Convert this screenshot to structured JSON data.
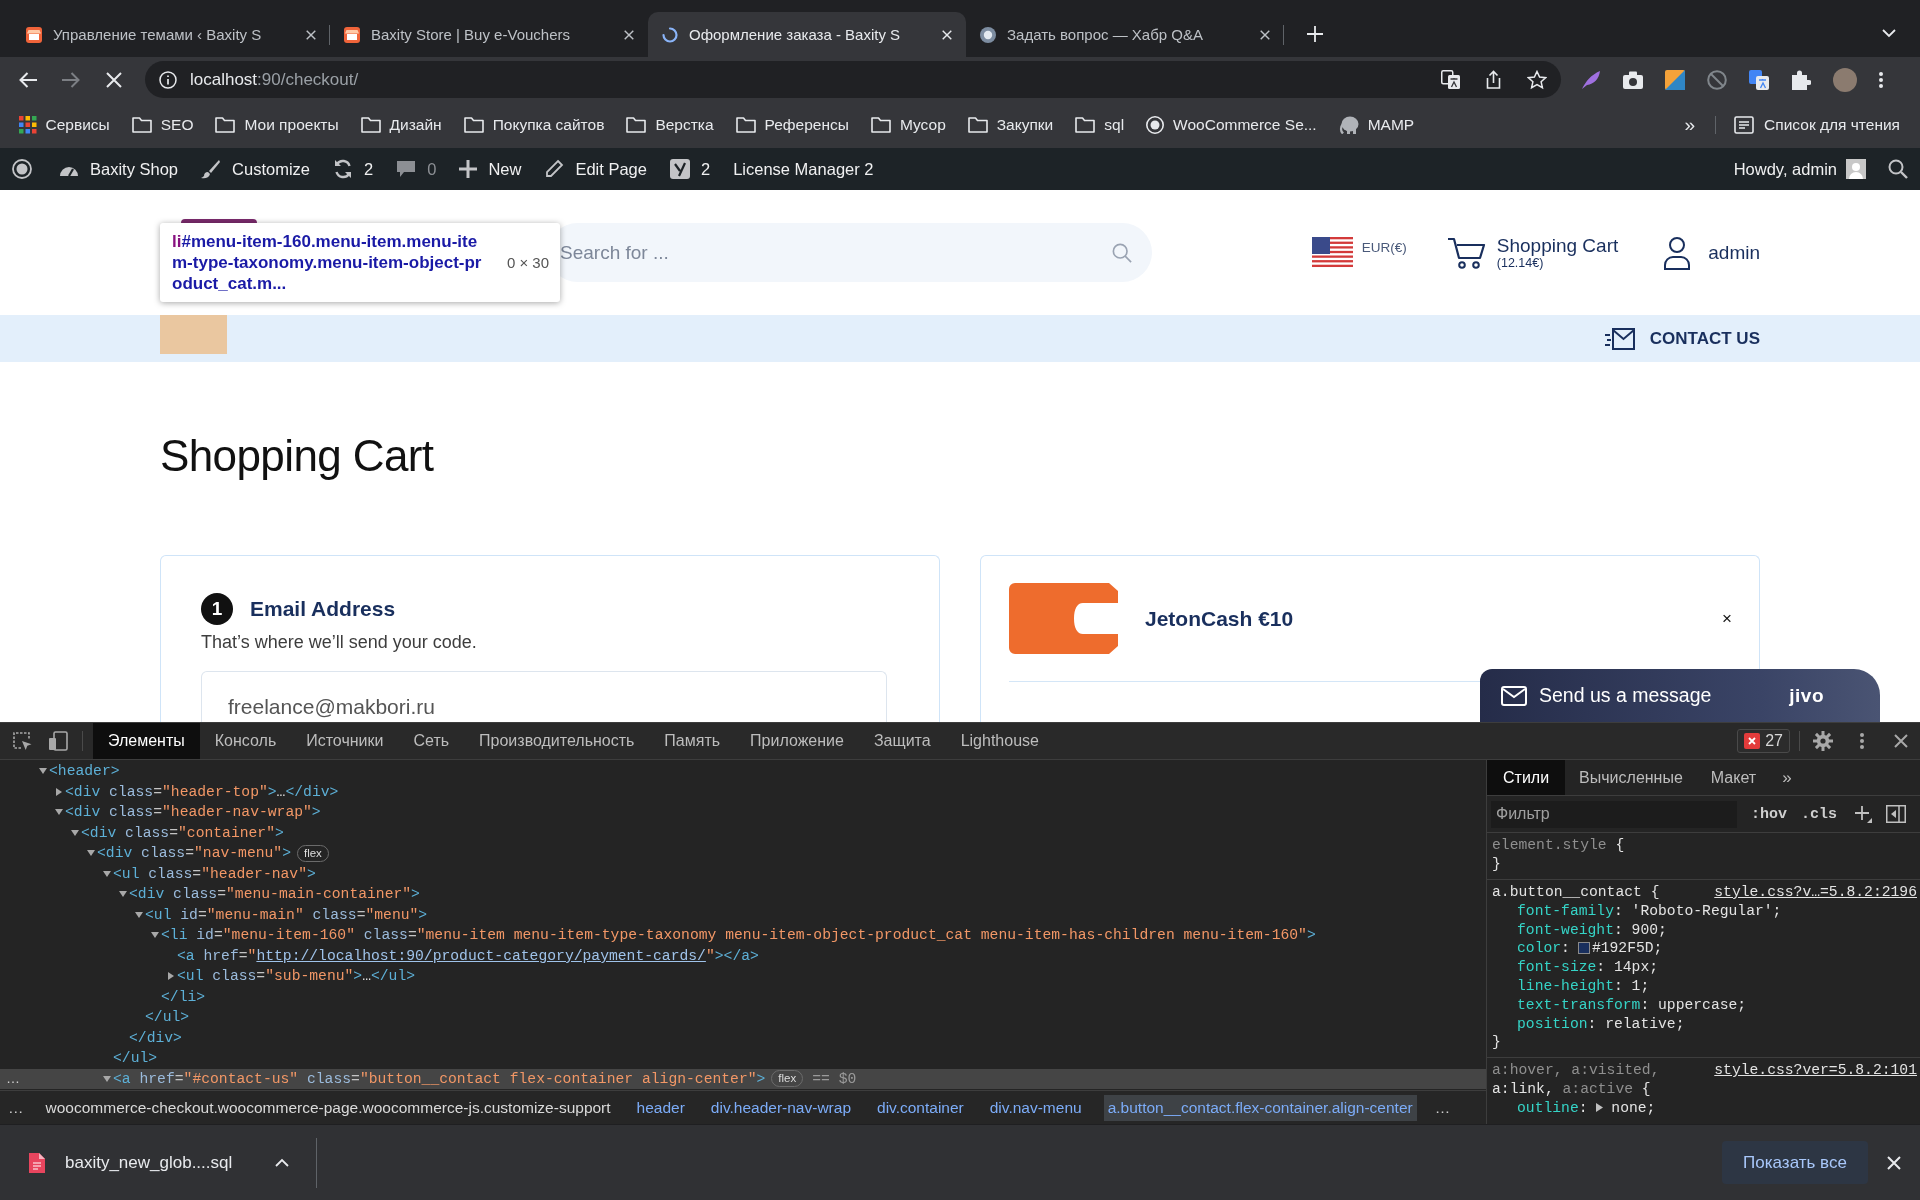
{
  "browser": {
    "tabs": [
      {
        "title": "Управление темами ‹ Baxity S",
        "kind": "shop",
        "selected": false
      },
      {
        "title": "Baxity Store | Buy e-Vouchers",
        "kind": "shop",
        "selected": false
      },
      {
        "title": "Оформление заказа - Baxity S",
        "kind": "loading",
        "selected": true
      },
      {
        "title": "Задать вопрос — Хабр Q&A",
        "kind": "bubble",
        "selected": false
      }
    ],
    "address": {
      "host": "localhost",
      "path": ":90/checkout/"
    },
    "bookmarks": [
      {
        "label": "Сервисы",
        "kind": "apps"
      },
      {
        "label": "SEO",
        "kind": "folder"
      },
      {
        "label": "Мои проекты",
        "kind": "folder"
      },
      {
        "label": "Дизайн",
        "kind": "folder"
      },
      {
        "label": "Покупка сайтов",
        "kind": "folder"
      },
      {
        "label": "Верстка",
        "kind": "folder"
      },
      {
        "label": "Референсы",
        "kind": "folder"
      },
      {
        "label": "Мусор",
        "kind": "folder"
      },
      {
        "label": "Закупки",
        "kind": "folder"
      },
      {
        "label": "sql",
        "kind": "folder"
      },
      {
        "label": "WooCommerce Se...",
        "kind": "circle"
      },
      {
        "label": "MAMP",
        "kind": "elephant"
      }
    ],
    "bookmarks_more": "»",
    "reading_list": "Список для чтения"
  },
  "admin_bar": {
    "items": [
      {
        "kind": "logo",
        "muted": false
      },
      {
        "kind": "dashboard",
        "label": "Baxity Shop",
        "muted": false
      },
      {
        "kind": "brush",
        "label": "Customize",
        "muted": false
      },
      {
        "kind": "updates",
        "label": "2",
        "muted": false
      },
      {
        "kind": "comments",
        "label": "0",
        "muted": true
      },
      {
        "kind": "new",
        "label": "New",
        "muted": false
      },
      {
        "kind": "edit",
        "label": "Edit Page",
        "muted": false
      },
      {
        "kind": "seo",
        "label": "2",
        "muted": false
      },
      {
        "kind": "text",
        "label": "License Manager 2",
        "muted": false
      }
    ],
    "greeting": "Howdy, admin"
  },
  "site": {
    "inspect_tooltip": {
      "tag": "li",
      "selector": "#menu-item-160.menu-item.menu-item-type-taxonomy.menu-item-object-product_cat.m...",
      "size": "0 × 30"
    },
    "search": {
      "placeholder": "Search for ..."
    },
    "currency": "EUR(€)",
    "cart": {
      "label": "Shopping Cart",
      "total": "(12.14€)"
    },
    "account": "admin",
    "contact": "CONTACT US",
    "title": "Shopping Cart",
    "email_step": {
      "number": "1",
      "title": "Email Address",
      "hint": "That’s where we’ll send your code.",
      "value": "freelance@makbori.ru"
    },
    "cart_item": {
      "name": "JetonCash €10",
      "remove": "×"
    },
    "chat": {
      "label": "Send us a message",
      "brand": "jivo"
    }
  },
  "devtools": {
    "tabs": [
      {
        "label": "Элементы",
        "selected": true
      },
      {
        "label": "Консоль",
        "selected": false
      },
      {
        "label": "Источники",
        "selected": false
      },
      {
        "label": "Сеть",
        "selected": false
      },
      {
        "label": "Производительность",
        "selected": false
      },
      {
        "label": "Память",
        "selected": false
      },
      {
        "label": "Приложение",
        "selected": false
      },
      {
        "label": "Защита",
        "selected": false
      },
      {
        "label": "Lighthouse",
        "selected": false
      }
    ],
    "error_count": "27",
    "dom": [
      {
        "markup": "<header>",
        "expanded": true,
        "selected": false,
        "children": [
          {
            "markup": "<div class=\"header-top\">…</div>",
            "expanded": false,
            "selected": false
          },
          {
            "markup": "<div class=\"header-nav-wrap\">",
            "expanded": true,
            "selected": false,
            "children": [
              {
                "markup": "<div class=\"container\">",
                "expanded": true,
                "selected": false,
                "children": [
                  {
                    "markup": "<div class=\"nav-menu\">",
                    "badge": "flex",
                    "expanded": true,
                    "selected": false,
                    "children": [
                      {
                        "markup": "<ul class=\"header-nav\">",
                        "expanded": true,
                        "selected": false,
                        "closing": "</ul>",
                        "children": [
                          {
                            "markup": "<div class=\"menu-main-container\">",
                            "expanded": true,
                            "selected": false,
                            "closing": "</div>",
                            "children": [
                              {
                                "markup": "<ul id=\"menu-main\" class=\"menu\">",
                                "expanded": true,
                                "selected": false,
                                "closing": "</ul>",
                                "children": [
                                  {
                                    "markup": "<li id=\"menu-item-160\" class=\"menu-item menu-item-type-taxonomy menu-item-object-product_cat menu-item-has-children menu-item-160\">",
                                    "expanded": true,
                                    "selected": false,
                                    "closing": "</li>",
                                    "children": [
                                      {
                                        "markup": "<a href=\"http://localhost:90/product-category/payment-cards/\"></a>",
                                        "link": true,
                                        "selected": false
                                      },
                                      {
                                        "markup": "<ul class=\"sub-menu\">…</ul>",
                                        "expanded": false,
                                        "selected": false
                                      }
                                    ]
                                  }
                                ]
                              }
                            ]
                          }
                        ]
                      },
                      {
                        "markup": "<a href=\"#contact-us\" class=\"button__contact flex-container align-center\">",
                        "badge": "flex",
                        "ref": "== $0",
                        "menu": "…",
                        "expanded": true,
                        "selected": true
                      }
                    ]
                  }
                ]
              }
            ]
          }
        ]
      }
    ],
    "crumbs": [
      {
        "label": "woocommerce-checkout.woocommerce-page.woocommerce-js.customize-support",
        "kind": "partial",
        "selected": false
      },
      {
        "label": "header",
        "kind": "element",
        "selected": false
      },
      {
        "label": "div.header-nav-wrap",
        "kind": "element",
        "selected": false
      },
      {
        "label": "div.container",
        "kind": "element",
        "selected": false
      },
      {
        "label": "div.nav-menu",
        "kind": "element",
        "selected": false
      },
      {
        "label": "a.button__contact.flex-container.align-center",
        "kind": "element",
        "selected": true
      }
    ],
    "crumbs_scroll": [
      "…",
      "…"
    ],
    "styles": {
      "tabs": [
        {
          "label": "Стили",
          "selected": true
        },
        {
          "label": "Вычисленные",
          "selected": false
        },
        {
          "label": "Макет",
          "selected": false
        }
      ],
      "tabs_more": "»",
      "filter": {
        "placeholder": "Фильтр"
      },
      "toggles": [
        ":hov",
        ".cls"
      ],
      "rules": [
        {
          "selector_lines": [
            [
              {
                "text": "element.style",
                "matched": false
              }
            ]
          ],
          "open": "{",
          "close": "}"
        },
        {
          "selector_lines": [
            [
              {
                "text": "a.button__contact",
                "matched": true
              }
            ]
          ],
          "open": "{",
          "source": "style.css?v…=5.8.2:2196",
          "declarations": [
            {
              "property": "font-family:",
              "value": "'Roboto-Regular';",
              "expandable": false
            },
            {
              "property": "font-weight:",
              "value": "900;",
              "expandable": false
            },
            {
              "property": "color:",
              "value": "#192F5D;",
              "color": "#192f5d",
              "expandable": false
            },
            {
              "property": "font-size:",
              "value": "14px;",
              "expandable": false
            },
            {
              "property": "line-height:",
              "value": "1;",
              "expandable": false
            },
            {
              "property": "text-transform:",
              "value": "uppercase;",
              "expandable": false
            },
            {
              "property": "position:",
              "value": "relative;",
              "expandable": false
            }
          ],
          "close": "}"
        },
        {
          "selector_lines": [
            [
              {
                "text": "a:hover,",
                "matched": false
              },
              {
                "text": "a:visited,",
                "matched": false
              }
            ],
            [
              {
                "text": "a:link,",
                "matched": true
              },
              {
                "text": "a:active",
                "matched": false
              }
            ]
          ],
          "open": "{",
          "source": "style.css?ver=5.8.2:101",
          "declarations": [
            {
              "property": "outline:",
              "value": "none;",
              "expandable": true
            }
          ]
        }
      ]
    }
  },
  "download": {
    "file": "baxity_new_glob....sql",
    "show_all": "Показать все"
  }
}
